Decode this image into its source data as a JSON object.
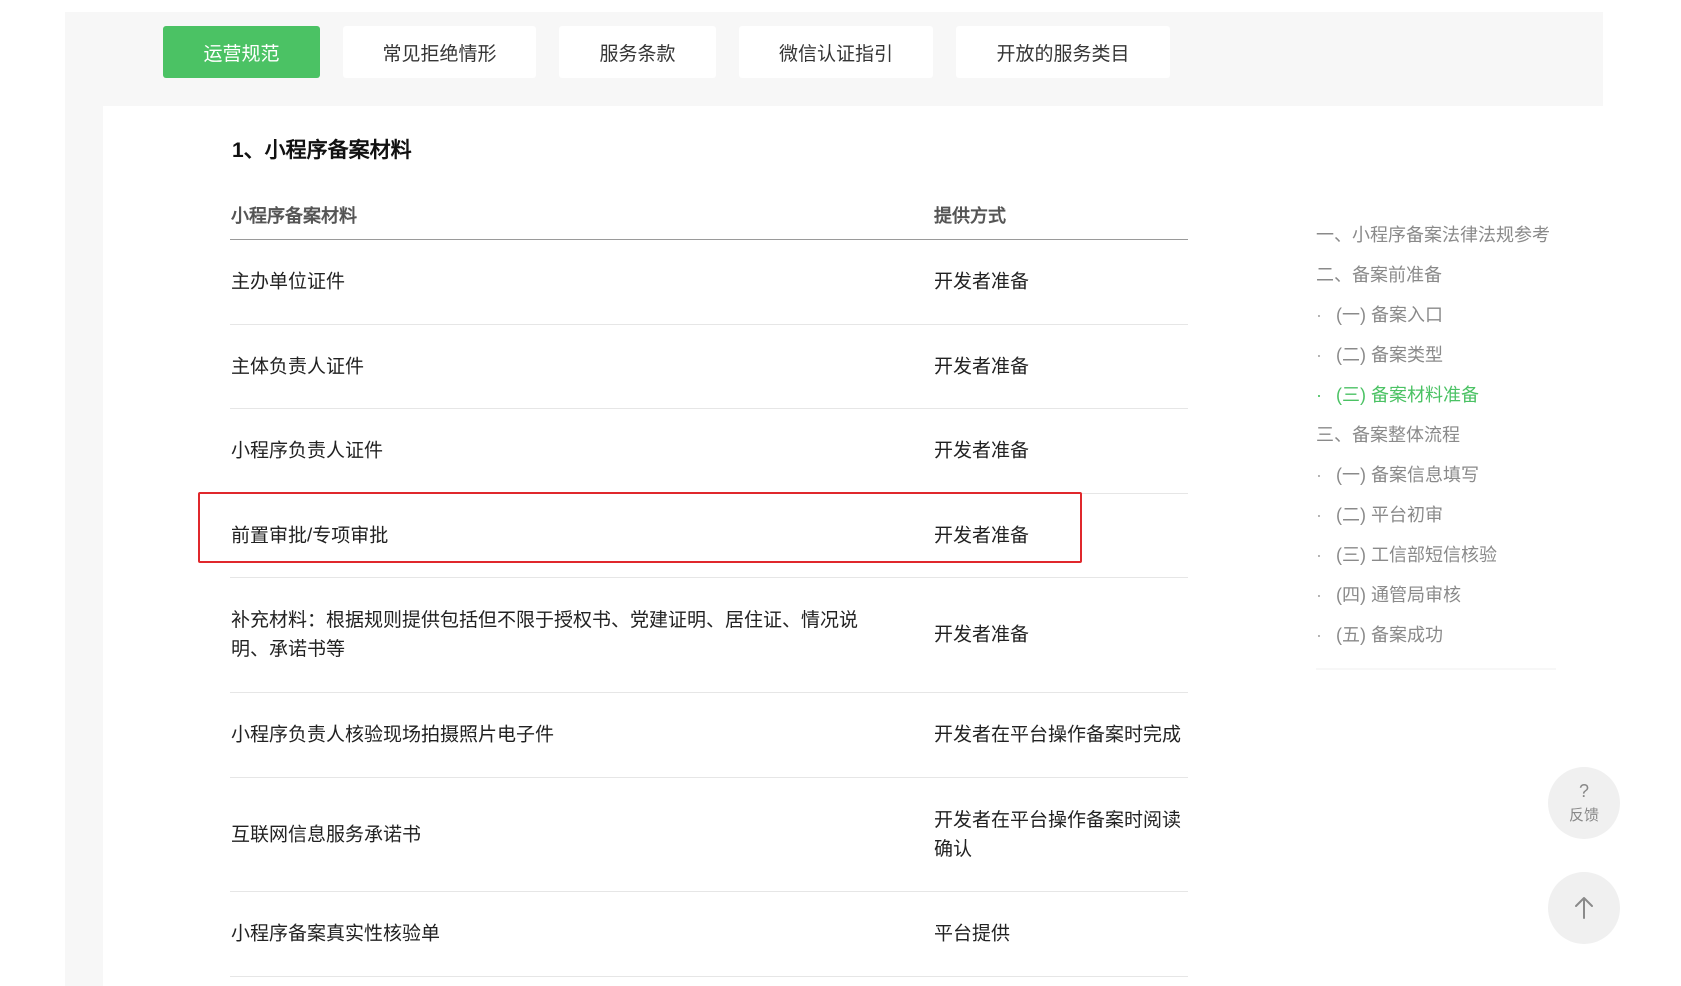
{
  "tabs": [
    {
      "label": "运营规范",
      "active": true
    },
    {
      "label": "常见拒绝情形",
      "active": false
    },
    {
      "label": "服务条款",
      "active": false
    },
    {
      "label": "微信认证指引",
      "active": false
    },
    {
      "label": "开放的服务类目",
      "active": false
    }
  ],
  "section_title": "1、小程序备案材料",
  "table": {
    "headers": [
      "小程序备案材料",
      "提供方式"
    ],
    "rows": [
      {
        "material": "主办单位证件",
        "method": "开发者准备"
      },
      {
        "material": "主体负责人证件",
        "method": "开发者准备"
      },
      {
        "material": "小程序负责人证件",
        "method": "开发者准备"
      },
      {
        "material": "前置审批/专项审批",
        "method": "开发者准备"
      },
      {
        "material": "补充材料：根据规则提供包括但不限于授权书、党建证明、居住证、情况说明、承诺书等",
        "method": "开发者准备"
      },
      {
        "material": "小程序负责人核验现场拍摄照片电子件",
        "method": "开发者在平台操作备案时完成"
      },
      {
        "material": "互联网信息服务承诺书",
        "method": "开发者在平台操作备案时阅读确认"
      },
      {
        "material": "小程序备案真实性核验单",
        "method": "平台提供"
      }
    ]
  },
  "toc": [
    {
      "label": "一、小程序备案法律法规参考",
      "sub": false,
      "active": false
    },
    {
      "label": "二、备案前准备",
      "sub": false,
      "active": false
    },
    {
      "label": "(一) 备案入口",
      "sub": true,
      "active": false
    },
    {
      "label": "(二) 备案类型",
      "sub": true,
      "active": false
    },
    {
      "label": "(三) 备案材料准备",
      "sub": true,
      "active": true
    },
    {
      "label": "三、备案整体流程",
      "sub": false,
      "active": false
    },
    {
      "label": "(一) 备案信息填写",
      "sub": true,
      "active": false
    },
    {
      "label": "(二) 平台初审",
      "sub": true,
      "active": false
    },
    {
      "label": "(三) 工信部短信核验",
      "sub": true,
      "active": false
    },
    {
      "label": "(四) 通管局审核",
      "sub": true,
      "active": false
    },
    {
      "label": "(五) 备案成功",
      "sub": true,
      "active": false
    }
  ],
  "toc_bullet": "·",
  "feedback": {
    "symbol": "?",
    "label": "反馈"
  },
  "colors": {
    "accent": "#4bc264",
    "highlight_border": "#e0282c"
  }
}
